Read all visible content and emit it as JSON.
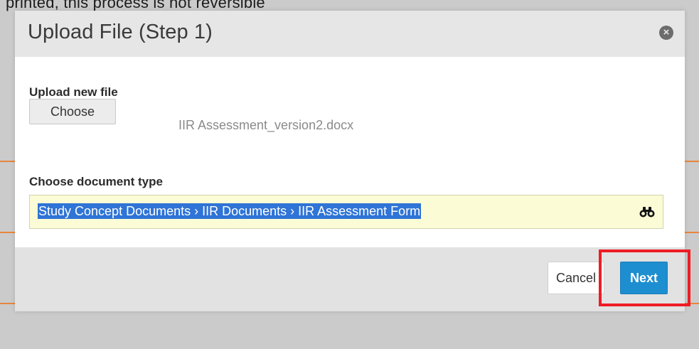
{
  "backdrop": {
    "text": "printed, this process is not reversible"
  },
  "dialog": {
    "title": "Upload File (Step 1)",
    "close_icon": "close-icon",
    "upload": {
      "label": "Upload new file",
      "choose_button": "Choose",
      "filename": "IIR Assessment_version2.docx"
    },
    "document_type": {
      "label": "Choose document type",
      "value": "Study Concept Documents › IIR Documents › IIR Assessment Form",
      "lookup_icon": "binoculars-icon"
    },
    "footer": {
      "cancel_button": "Cancel",
      "next_button": "Next"
    }
  },
  "colors": {
    "primary_button": "#1d8ecf",
    "highlight_annotation": "#ee1c24",
    "field_background": "#fbfbd6",
    "selection": "#2f74d6",
    "backdrop_accent": "#e8853d"
  }
}
